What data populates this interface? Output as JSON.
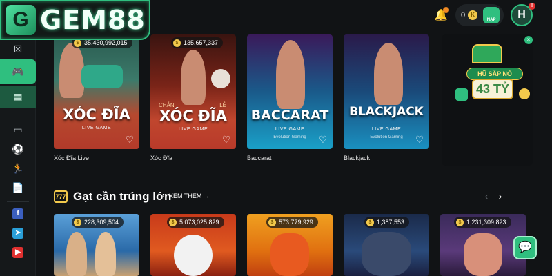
{
  "brand": {
    "logo_letter": "G",
    "name": "GEM88"
  },
  "topbar": {
    "notifications_count": "!",
    "wallet_balance": "0",
    "coin_symbol": "K",
    "deposit_label": "NẠP",
    "avatar_initial": "H",
    "avatar_badge": "!"
  },
  "sidebar": {
    "social": [
      "f",
      "➤",
      "▶"
    ]
  },
  "live_games": [
    {
      "name": "Xóc Đĩa Live",
      "title": "XÓC ĐĨA",
      "subtitle": "LIVE GAME",
      "jackpot": "35,430,992,015"
    },
    {
      "name": "Xóc Đĩa",
      "title": "XÓC ĐĨA",
      "subtitle": "LIVE GAME",
      "jackpot": "135,657,337",
      "extra_left": "CHẴN",
      "extra_right": "LẺ"
    },
    {
      "name": "Baccarat",
      "title": "BACCARAT",
      "subtitle": "LIVE GAME",
      "provider": "Evolution Gaming"
    },
    {
      "name": "Blackjack",
      "title": "BLACKJACK",
      "subtitle": "LIVE GAME",
      "provider": "Evolution Gaming"
    }
  ],
  "promo": {
    "badge": "HŨ SẮP NỔ",
    "value": "43 TỶ"
  },
  "jackpot_section": {
    "icon_text": "777",
    "title": "Gạt cần trúng lớn",
    "see_more": "XEM THÊM →",
    "games": [
      {
        "jackpot": "228,309,504"
      },
      {
        "jackpot": "5,073,025,829"
      },
      {
        "jackpot": "573,779,929"
      },
      {
        "jackpot": "1,387,553"
      },
      {
        "jackpot": "1,231,309,823"
      }
    ]
  },
  "colors": {
    "accent": "#2fbf7f",
    "background": "#111315",
    "gold": "#f2c94c"
  }
}
